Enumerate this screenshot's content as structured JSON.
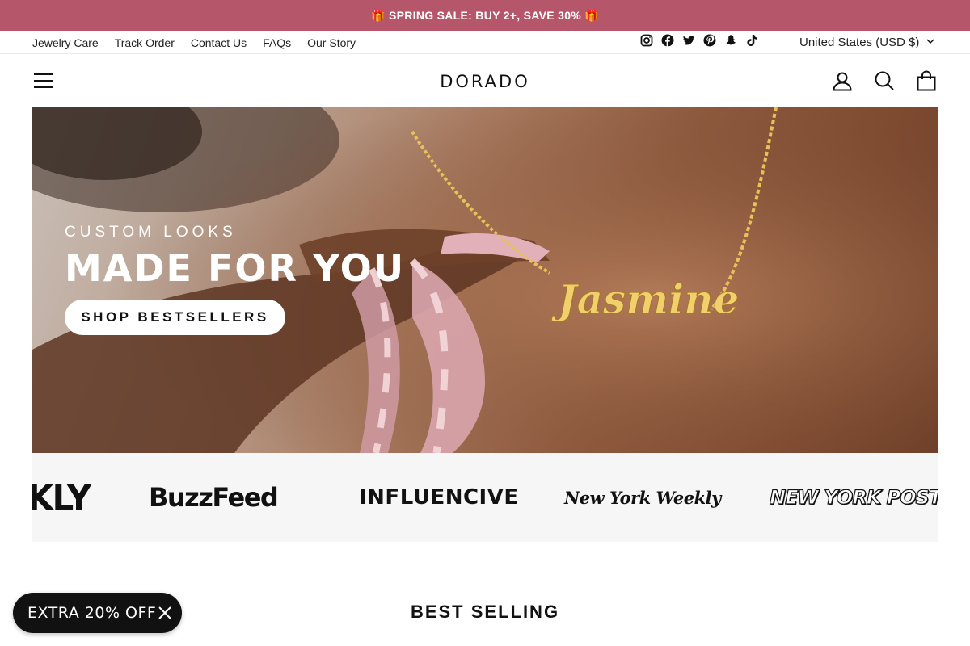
{
  "announcement": "🎁 SPRING SALE: BUY 2+, SAVE 30% 🎁",
  "utility_nav": {
    "links": [
      "Jewelry Care",
      "Track Order",
      "Contact Us",
      "FAQs",
      "Our Story"
    ],
    "socials": [
      "instagram-icon",
      "facebook-icon",
      "twitter-icon",
      "pinterest-icon",
      "snapchat-icon",
      "tiktok-icon"
    ],
    "currency": "United States (USD $)"
  },
  "header": {
    "logo": "DORADO",
    "icons": [
      "menu-icon",
      "account-icon",
      "search-icon",
      "cart-icon"
    ]
  },
  "hero": {
    "subtitle": "CUSTOM LOOKS",
    "title": "MADE FOR YOU",
    "cta": "SHOP BESTSELLERS",
    "necklace_text": "Jasmine"
  },
  "press": [
    "KLY",
    "BuzzFeed",
    "INFLUENCIVE",
    "New York Weekly",
    "NEW YORK POST"
  ],
  "best_selling_title": "BEST SELLING",
  "promo": {
    "label": "EXTRA 20% OFF"
  },
  "colors": {
    "announcement_bg": "#b5566a",
    "promo_bg": "#111111",
    "press_bg": "#f6f6f6"
  }
}
